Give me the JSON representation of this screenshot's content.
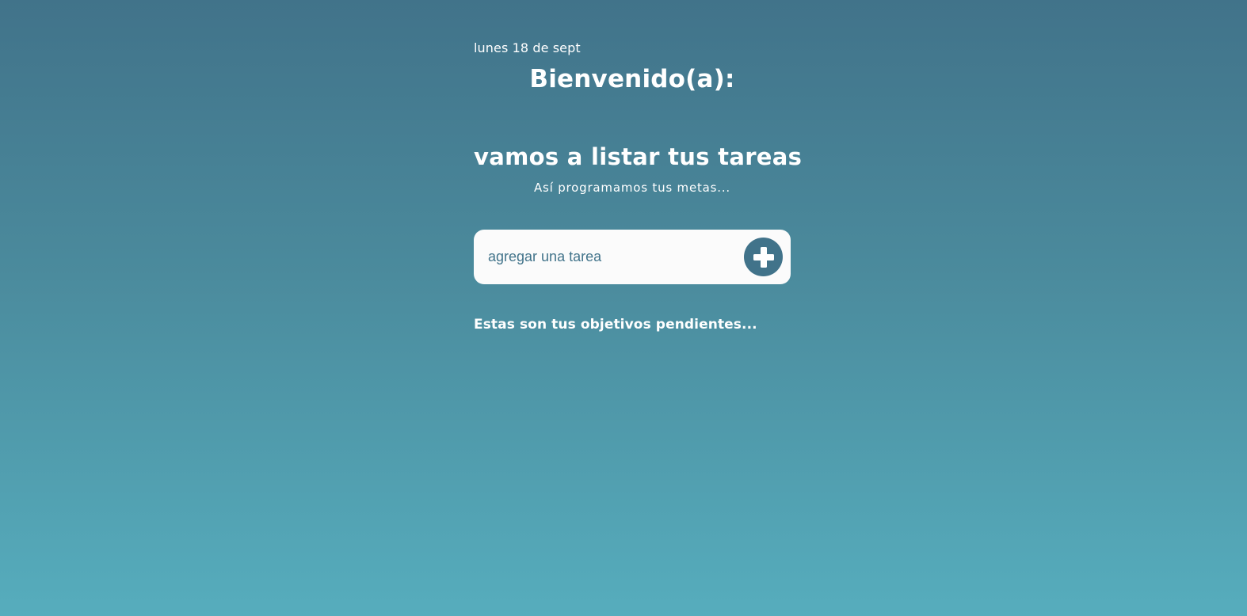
{
  "header": {
    "date": "lunes 18 de sept",
    "welcome": "Bienvenido(a):"
  },
  "intro": {
    "headline": "vamos a listar tus tareas",
    "subhead": "Así programamos tus metas..."
  },
  "task_form": {
    "placeholder": "agregar una tarea",
    "value": "",
    "add_icon": "plus-circle-icon"
  },
  "pending": {
    "title": "Estas son tus objetivos pendientes...",
    "items": []
  },
  "colors": {
    "accent": "#41738a",
    "background_top": "#41738a",
    "background_bottom": "#56adbd",
    "input_background": "#fbfbfb",
    "text": "#ffffff"
  }
}
